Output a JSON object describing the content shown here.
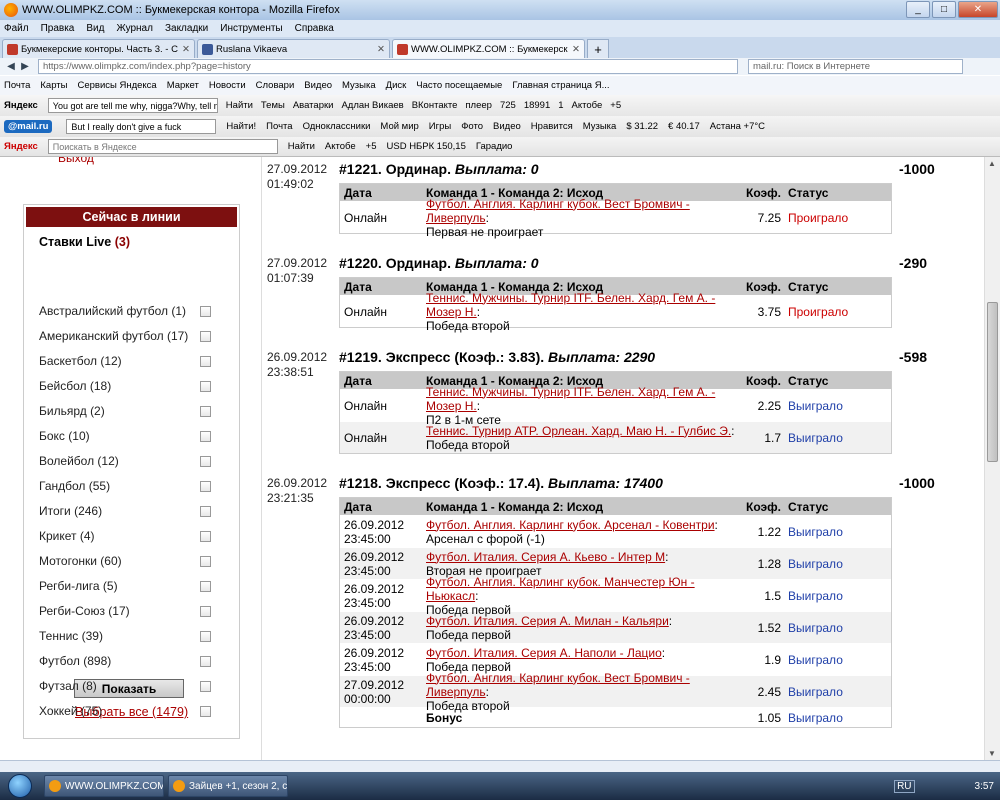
{
  "window": {
    "title": "WWW.OLIMPKZ.COM :: Букмекерская контора - Mozilla Firefox",
    "min": "_",
    "max": "□",
    "close": "✕"
  },
  "menu": [
    "Файл",
    "Правка",
    "Вид",
    "Журнал",
    "Закладки",
    "Инструменты",
    "Справка"
  ],
  "tabs": [
    {
      "label": "Букмекерские конторы. Часть 3. - Стр...",
      "color": "#c0392b"
    },
    {
      "label": "Ruslana Vikaeva",
      "color": "#3b5998"
    },
    {
      "label": "WWW.OLIMPKZ.COM :: Букмекерская к...",
      "color": "#c0392b",
      "active": true
    }
  ],
  "nav": {
    "url": "https://www.olimpkz.com/index.php?page=history",
    "search_placeholder": "mail.ru: Поиск в Интернете"
  },
  "bookmarks": [
    "Почта",
    "Карты",
    "Сервисы Яндекса",
    "Маркет",
    "Новости",
    "Словари",
    "Видео",
    "Музыка",
    "Диск",
    "Часто посещаемые",
    "Главная страница Я..."
  ],
  "toolbar1": {
    "logo": "Яндекс",
    "input": "You got are tell me why, nigga?Why, tell m",
    "find": "Найти",
    "items": [
      "Темы",
      "Аватарки",
      "Адлан Викаев",
      "ВКонтакте",
      "плеер",
      "725",
      "18991",
      "1",
      "Актобе",
      "+5"
    ]
  },
  "toolbar2": {
    "logo": "@mail.ru",
    "input": "But I really don't give a fuck",
    "find": "Найти!",
    "items": [
      "Почта",
      "Одноклассники",
      "Мой мир",
      "Игры",
      "Фото",
      "Видео",
      "Нравится",
      "Музыка",
      "$ 31.22",
      "€ 40.17",
      "Астана +7°C"
    ]
  },
  "toolbar3": {
    "logo": "Яндекс",
    "placeholder": "Поискать в Яндексе",
    "find": "Найти",
    "items": [
      "Актобе",
      "+5",
      "USD НБРК 150,15",
      "Гарадио"
    ]
  },
  "left": {
    "exit": "Выход",
    "panel_title": "Сейчас в линии",
    "live_label": "Ставки Live",
    "live_count": "(3)",
    "sports": [
      "Австралийский футбол (1)",
      "Американский футбол (17)",
      "Баскетбол (12)",
      "Бейсбол (18)",
      "Бильярд (2)",
      "Бокс (10)",
      "Волейбол (12)",
      "Гандбол (55)",
      "Итоги (246)",
      "Крикет (4)",
      "Мотогонки (60)",
      "Регби-лига (5)",
      "Регби-Союз (17)",
      "Теннис (39)",
      "Футбол (898)",
      "Футзал (8)",
      "Хоккей (75)"
    ],
    "show_button": "Показать",
    "select_all": "Выбрать все (1479)"
  },
  "table_headers": {
    "date": "Дата",
    "match": "Команда 1 - Команда 2: Исход",
    "coef": "Коэф.",
    "status": "Статус"
  },
  "bets": [
    {
      "date": "27.09.2012",
      "time": "01:49:02",
      "title": "#1221. Ординар.",
      "payout": "Выплата: 0",
      "sum": "-1000",
      "rows": [
        {
          "d1": "Онлайн",
          "d2": "",
          "link": "Футбол. Англия. Карлинг кубок. Вест Бромвич - Ливерпуль",
          "outcome": "Первая не проиграет",
          "coef": "7.25",
          "status": "Проиграло",
          "st": "lose"
        }
      ]
    },
    {
      "date": "27.09.2012",
      "time": "01:07:39",
      "title": "#1220. Ординар.",
      "payout": "Выплата: 0",
      "sum": "-290",
      "rows": [
        {
          "d1": "Онлайн",
          "d2": "",
          "link": "Теннис. Мужчины. Турнир ITF. Белен. Хард. Гем А. - Мозер Н.",
          "outcome": "Победа второй",
          "coef": "3.75",
          "status": "Проиграло",
          "st": "lose"
        }
      ]
    },
    {
      "date": "26.09.2012",
      "time": "23:38:51",
      "title": "#1219. Экспресс (Коэф.: 3.83).",
      "payout": "Выплата: 2290",
      "sum": "-598",
      "rows": [
        {
          "d1": "Онлайн",
          "d2": "",
          "link": "Теннис. Мужчины. Турнир ITF. Белен. Хард. Гем А. - Мозер Н.",
          "outcome": "П2 в 1-м сете",
          "coef": "2.25",
          "status": "Выиграло",
          "st": "win"
        },
        {
          "d1": "Онлайн",
          "d2": "",
          "link": "Теннис. Турнир ATP. Орлеан. Хард. Маю Н. - Гулбис Э.",
          "outcome": "Победа второй",
          "coef": "1.7",
          "status": "Выиграло",
          "st": "win"
        }
      ]
    },
    {
      "date": "26.09.2012",
      "time": "23:21:35",
      "title": "#1218. Экспресс (Коэф.: 17.4).",
      "payout": "Выплата: 17400",
      "sum": "-1000",
      "rows": [
        {
          "d1": "26.09.2012",
          "d2": "23:45:00",
          "link": "Футбол. Англия. Карлинг кубок. Арсенал - Ковентри",
          "outcome": "Арсенал с форой (-1)",
          "coef": "1.22",
          "status": "Выиграло",
          "st": "win"
        },
        {
          "d1": "26.09.2012",
          "d2": "23:45:00",
          "link": "Футбол. Италия. Серия А. Кьево - Интер М",
          "outcome": "Вторая не проиграет",
          "coef": "1.28",
          "status": "Выиграло",
          "st": "win"
        },
        {
          "d1": "26.09.2012",
          "d2": "23:45:00",
          "link": "Футбол. Англия. Карлинг кубок. Манчестер Юн - Ньюкасл",
          "outcome": "Победа первой",
          "coef": "1.5",
          "status": "Выиграло",
          "st": "win"
        },
        {
          "d1": "26.09.2012",
          "d2": "23:45:00",
          "link": "Футбол. Италия. Серия А. Милан - Кальяри",
          "outcome": "Победа первой",
          "coef": "1.52",
          "status": "Выиграло",
          "st": "win"
        },
        {
          "d1": "26.09.2012",
          "d2": "23:45:00",
          "link": "Футбол. Италия. Серия А. Наполи - Лацио",
          "outcome": "Победа первой",
          "coef": "1.9",
          "status": "Выиграло",
          "st": "win"
        },
        {
          "d1": "27.09.2012",
          "d2": "00:00:00",
          "link": "Футбол. Англия. Карлинг кубок. Вест Бромвич - Ливерпуль",
          "outcome": "Победа второй",
          "coef": "2.45",
          "status": "Выиграло",
          "st": "win"
        },
        {
          "d1": "",
          "d2": "",
          "link": "",
          "outcome": "Бонус",
          "coef": "1.05",
          "status": "Выиграло",
          "st": "win",
          "bonus": true
        }
      ]
    }
  ],
  "taskbar": {
    "tasks": [
      "WWW.OLIMPKZ.COM ...",
      "Зайцев +1, сезон 2, с..."
    ],
    "lang": "RU",
    "time": "3:57"
  }
}
